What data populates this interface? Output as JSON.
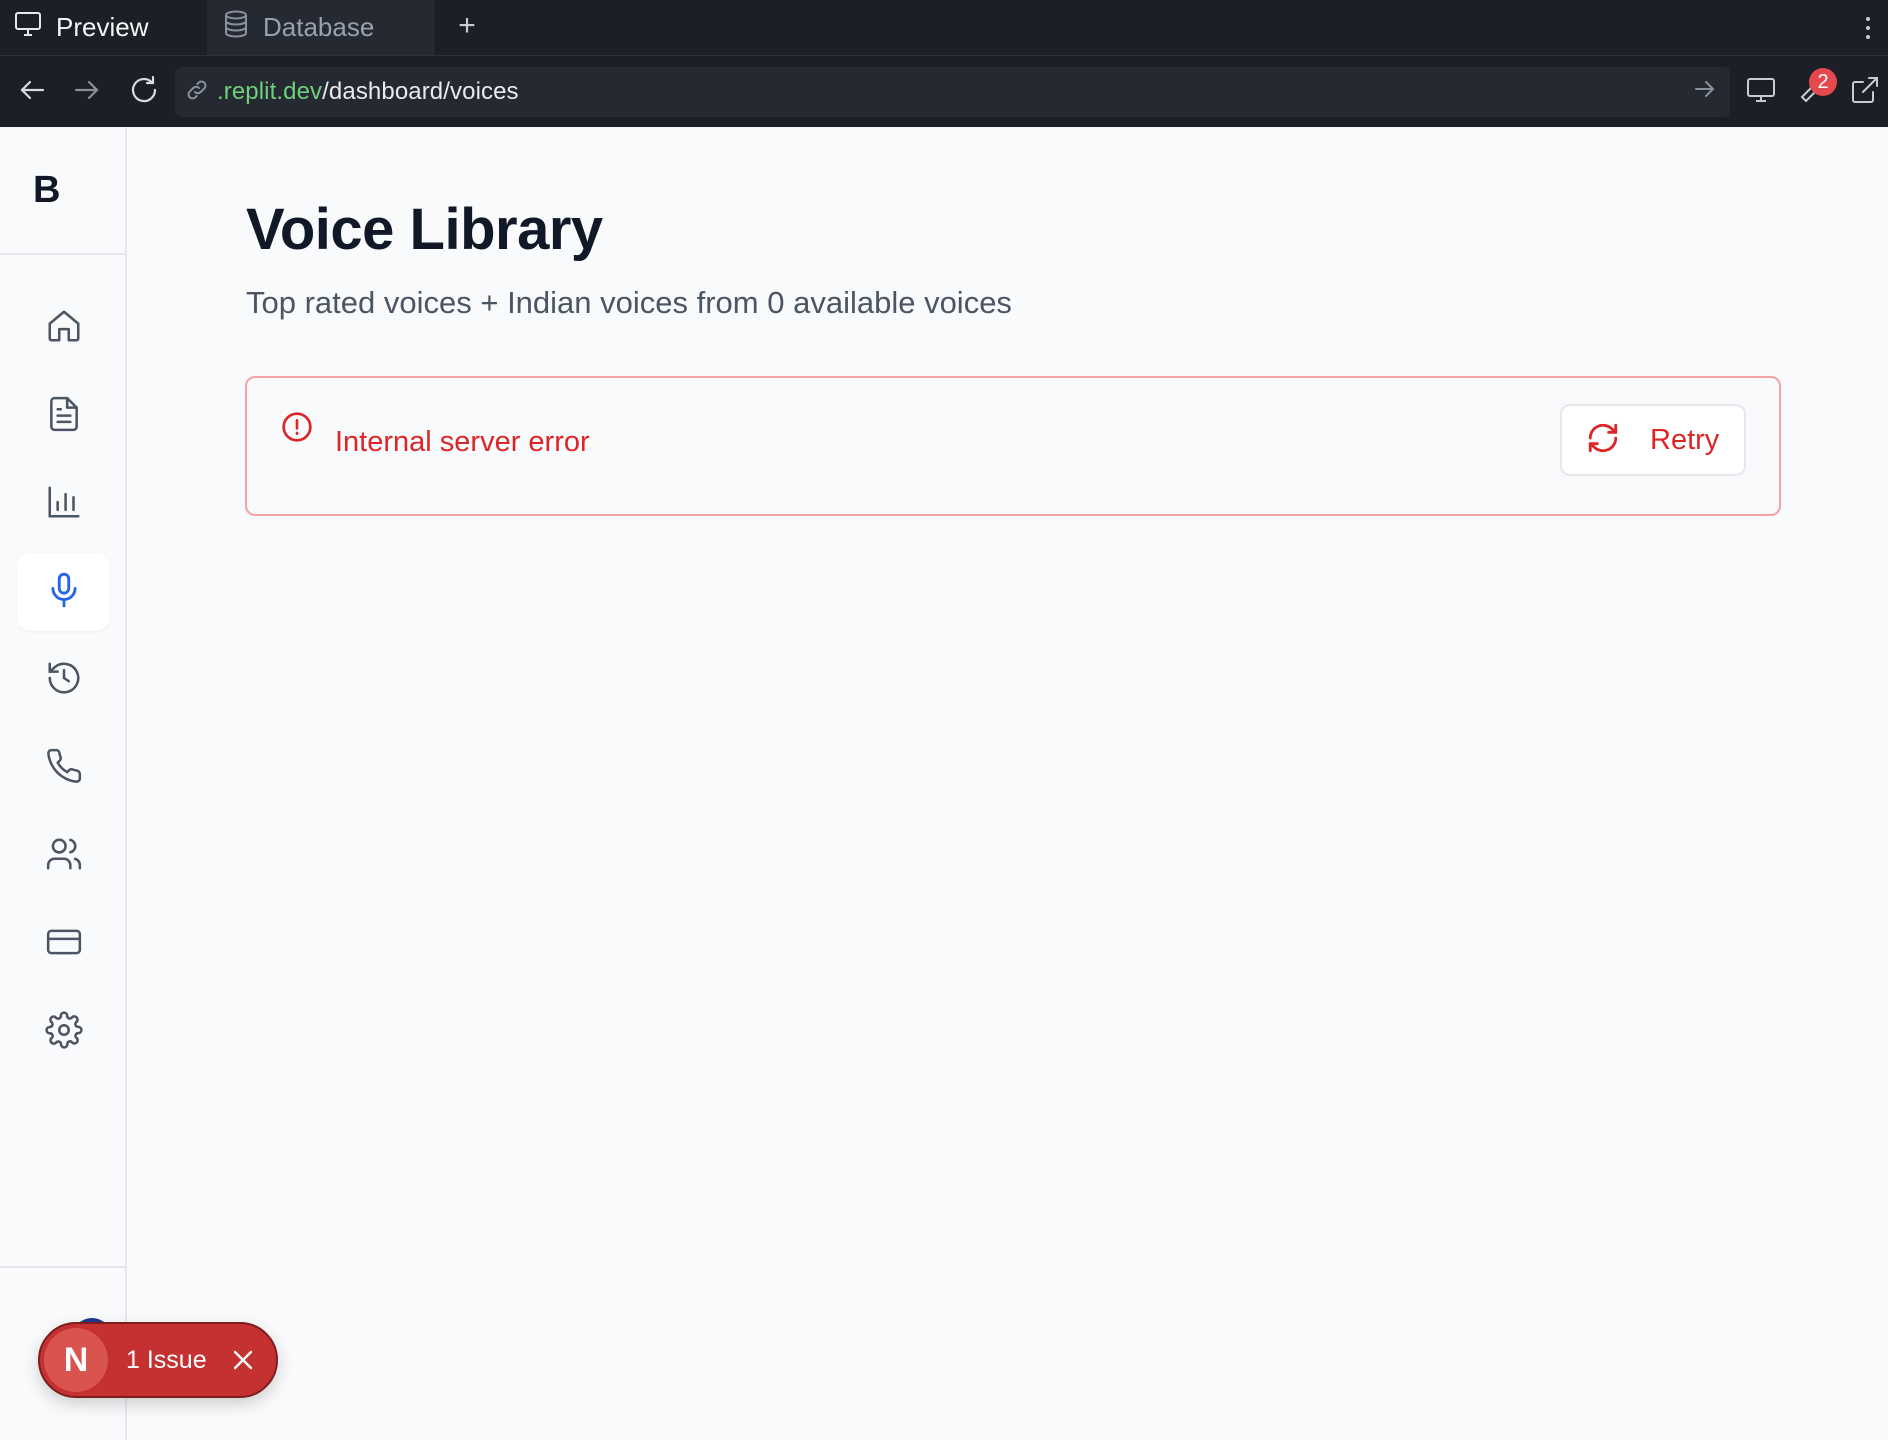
{
  "tabs": [
    {
      "label": "Preview",
      "icon": "monitor-icon",
      "active": true
    },
    {
      "label": "Database",
      "icon": "database-icon",
      "active": false
    }
  ],
  "tab_add_label": "+",
  "url": {
    "host": ".replit.dev",
    "path": "/dashboard/voices"
  },
  "devtools_badge": "2",
  "logo": "B",
  "sidebar": {
    "items": [
      {
        "icon": "home-icon",
        "active": false
      },
      {
        "icon": "document-icon",
        "active": false
      },
      {
        "icon": "bar-chart-icon",
        "active": false
      },
      {
        "icon": "microphone-icon",
        "active": true
      },
      {
        "icon": "history-icon",
        "active": false
      },
      {
        "icon": "phone-icon",
        "active": false
      },
      {
        "icon": "users-icon",
        "active": false
      },
      {
        "icon": "credit-card-icon",
        "active": false
      },
      {
        "icon": "gear-icon",
        "active": false
      }
    ]
  },
  "page": {
    "title": "Voice Library",
    "subtitle": "Top rated voices + Indian voices from 0 available voices"
  },
  "error": {
    "message": "Internal server error",
    "retry_label": "Retry"
  },
  "issue_pill": {
    "avatar_letter": "N",
    "label": "1 Issue"
  },
  "colors": {
    "accent": "#2563eb",
    "error": "#dc2626",
    "error_border": "#f3a3a3",
    "chrome_bg": "#1c1f26",
    "url_host": "#6fcf7a"
  }
}
